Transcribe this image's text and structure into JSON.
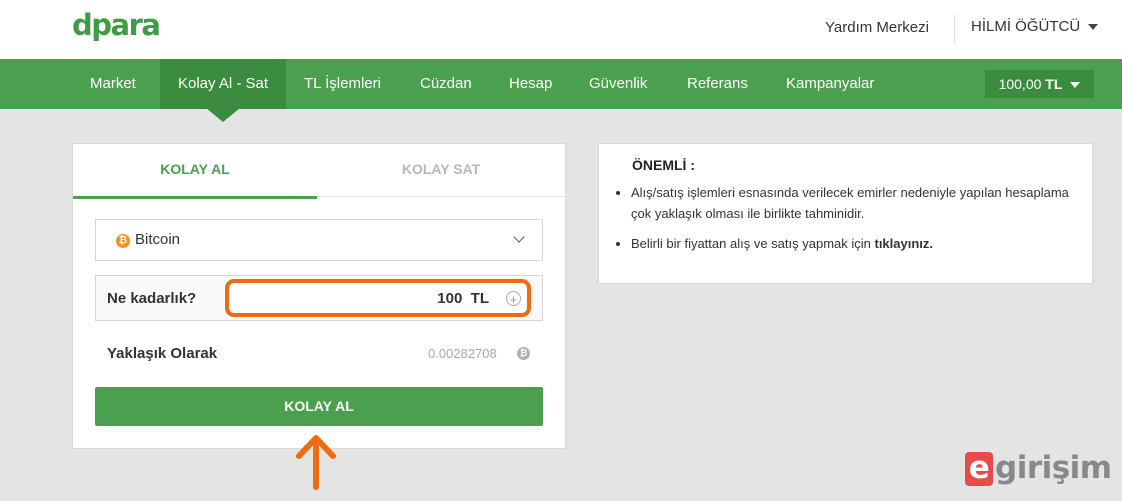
{
  "header": {
    "logo": "dpara",
    "help_link": "Yardım Merkezi",
    "user_name": "HİLMİ ÖĞÜTCÜ"
  },
  "nav": {
    "items": [
      {
        "label": "Market"
      },
      {
        "label": "Kolay Al - Sat",
        "active": true
      },
      {
        "label": "TL İşlemleri"
      },
      {
        "label": "Cüzdan"
      },
      {
        "label": "Hesap"
      },
      {
        "label": "Güvenlik"
      },
      {
        "label": "Referans"
      },
      {
        "label": "Kampanyalar"
      }
    ],
    "balance_amount": "100,00",
    "balance_currency": "TL"
  },
  "trade": {
    "tabs": [
      {
        "label": "KOLAY AL",
        "active": true
      },
      {
        "label": "KOLAY SAT",
        "active": false
      }
    ],
    "coin_symbol": "₿",
    "coin_name": "Bitcoin",
    "amount_label": "Ne kadarlık?",
    "amount_value": "100",
    "amount_currency": "TL",
    "approx_label": "Yaklaşık Olarak",
    "approx_value": "0.00282708",
    "buy_button": "KOLAY AL"
  },
  "info": {
    "title": "ÖNEMLİ :",
    "item1": "Alış/satış işlemleri esnasında verilecek emirler nedeniyle yapılan hesaplama çok yaklaşık olması ile birlikte tahminidir.",
    "item2_text": "Belirli bir fiyattan alış ve satış yapmak için ",
    "item2_link": "tıklayınız."
  },
  "watermark": {
    "e": "e",
    "rest": "girişim"
  },
  "colors": {
    "brand_green": "#4ba04f",
    "active_green": "#3c8c40",
    "highlight_orange": "#f06a0f",
    "bitcoin_orange": "#f7931a"
  }
}
